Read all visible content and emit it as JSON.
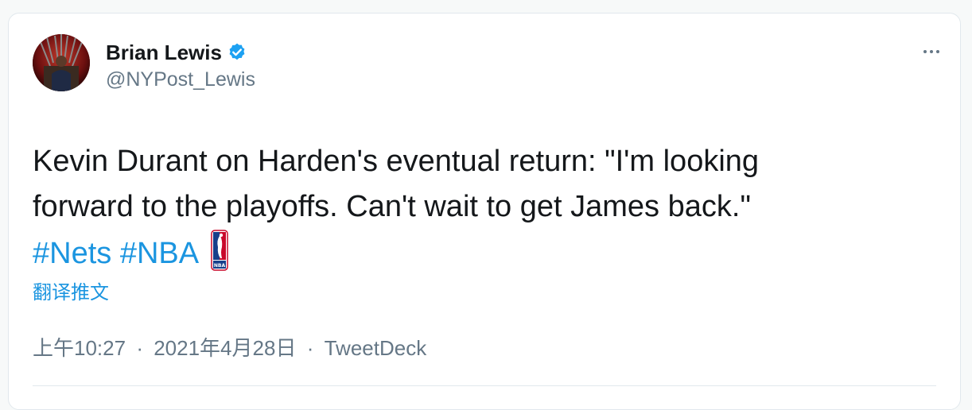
{
  "author": {
    "name": "Brian Lewis",
    "handle": "@NYPost_Lewis",
    "verified": true
  },
  "tweet": {
    "text_lines": [
      "Kevin Durant on Harden's eventual return: \"I'm looking",
      "forward to the playoffs. Can't wait to get James back.\""
    ],
    "hashtags": [
      "#Nets",
      "#NBA"
    ],
    "translate_label": "翻译推文"
  },
  "meta": {
    "time": "上午10:27",
    "separator": "·",
    "date": "2021年4月28日",
    "source": "TweetDeck"
  },
  "icons": {
    "verified": "verified-badge-icon",
    "more": "more-options-icon",
    "nba": "nba-logo-icon"
  },
  "colors": {
    "link": "#1b95e0",
    "secondary_text": "#657786",
    "primary_text": "#14171a",
    "verified_badge": "#1da1f2"
  }
}
